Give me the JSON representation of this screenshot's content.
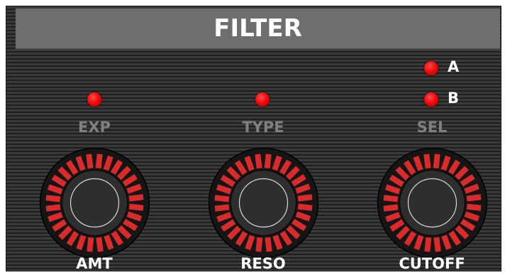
{
  "panel": {
    "title": "FILTER"
  },
  "selector": {
    "option_a": "A",
    "option_b": "B"
  },
  "buttons": [
    {
      "label": "EXP"
    },
    {
      "label": "TYPE"
    },
    {
      "label": "SEL"
    }
  ],
  "knobs": [
    {
      "label": "AMT"
    },
    {
      "label": "RESO"
    },
    {
      "label": "CUTOFF"
    }
  ],
  "colors": {
    "led": "#ee0000",
    "segment": "#d92b2b",
    "title_bar": "#6e6e6e",
    "inactive_text": "#808080"
  },
  "icons": {
    "led": "red-led-icon",
    "knob_ring": "segmented-ring-icon"
  }
}
